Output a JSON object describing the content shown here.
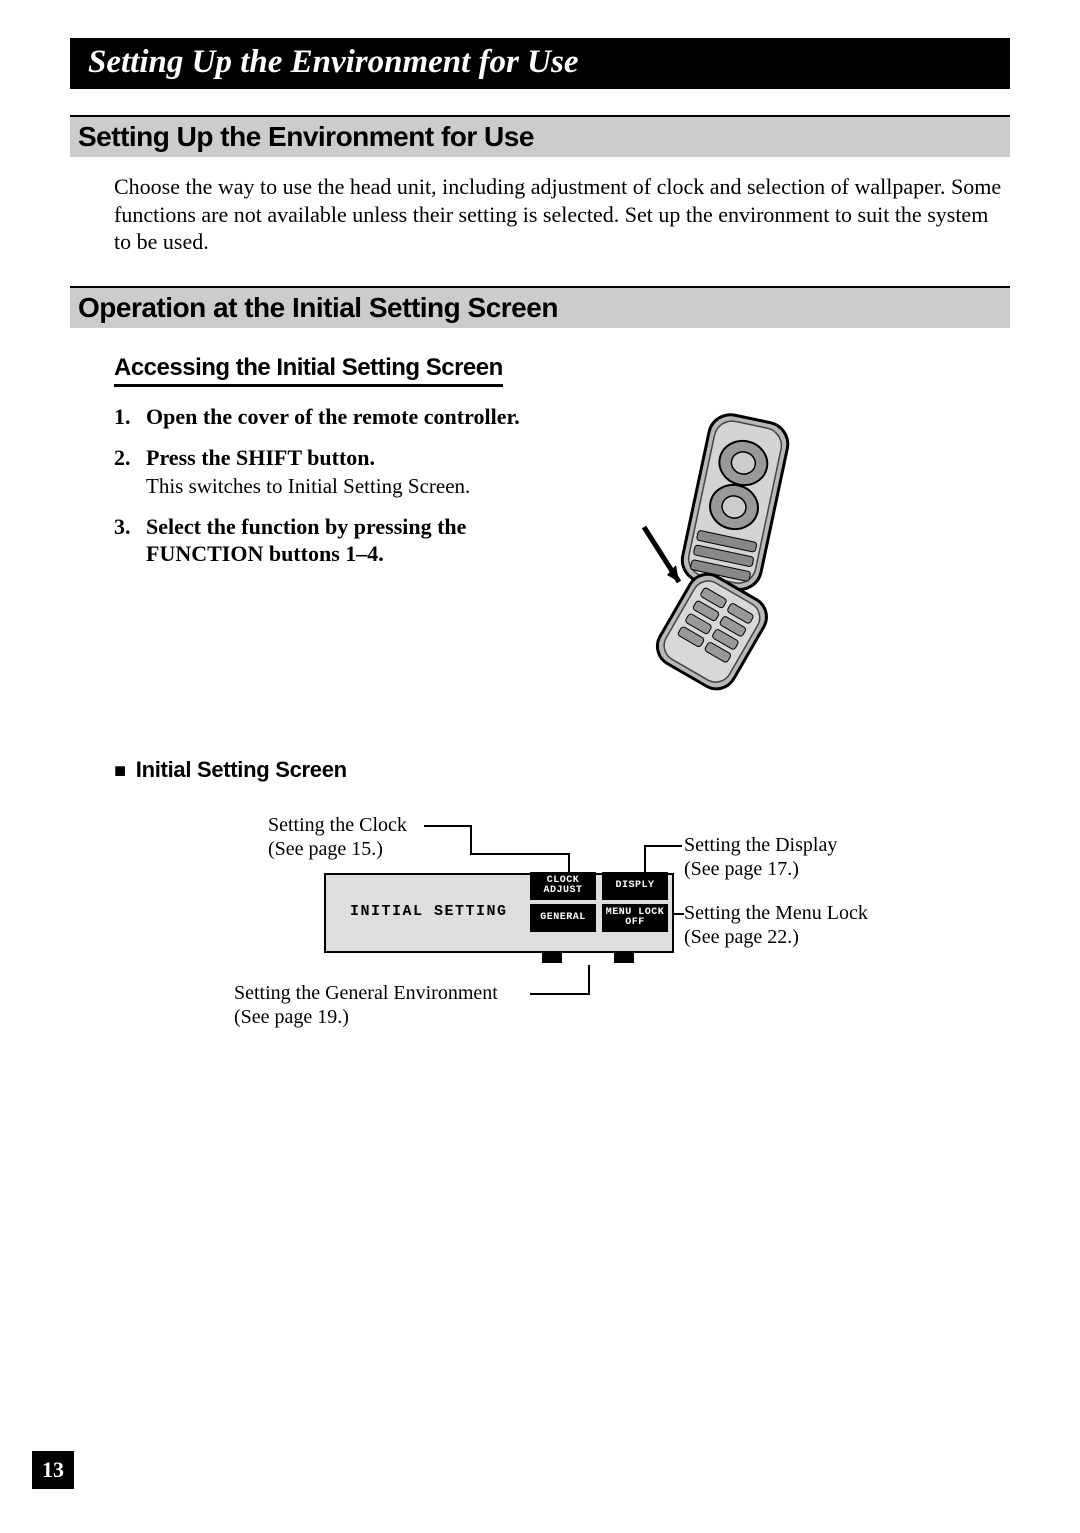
{
  "titleBar": "Setting Up the Environment for Use",
  "section1": {
    "heading": "Setting Up the Environment for Use",
    "intro": "Choose the way to use the head unit, including adjustment of clock and selection of wallpaper. Some functions are not available unless their setting is selected. Set up the environment to suit the system to be used."
  },
  "section2": {
    "heading": "Operation at the Initial Setting Screen",
    "subheading": "Accessing the Initial Setting Screen",
    "steps": [
      {
        "num": "1.",
        "text": "Open the cover of the remote controller.",
        "note": ""
      },
      {
        "num": "2.",
        "text": "Press the SHIFT button.",
        "note": "This switches to Initial Setting Screen."
      },
      {
        "num": "3.",
        "text": "Select the function by pressing the FUNCTION buttons 1–4.",
        "note": ""
      }
    ]
  },
  "diagram": {
    "bulletHead": "Initial Setting Screen",
    "lcdTitle": "INITIAL SETTING",
    "buttons": {
      "clock": "CLOCK\nADJUST",
      "disply": "DISPLY",
      "general": "GENERAL",
      "menulock": "MENU LOCK\nOFF"
    },
    "callouts": {
      "clock": {
        "label": "Setting the Clock",
        "ref": "(See page 15.)"
      },
      "display": {
        "label": "Setting the Display",
        "ref": "(See page 17.)"
      },
      "menulock": {
        "label": "Setting the Menu Lock",
        "ref": "(See page 22.)"
      },
      "general": {
        "label": "Setting the General Environment",
        "ref": "(See page 19.)"
      }
    }
  },
  "pageNumber": "13"
}
